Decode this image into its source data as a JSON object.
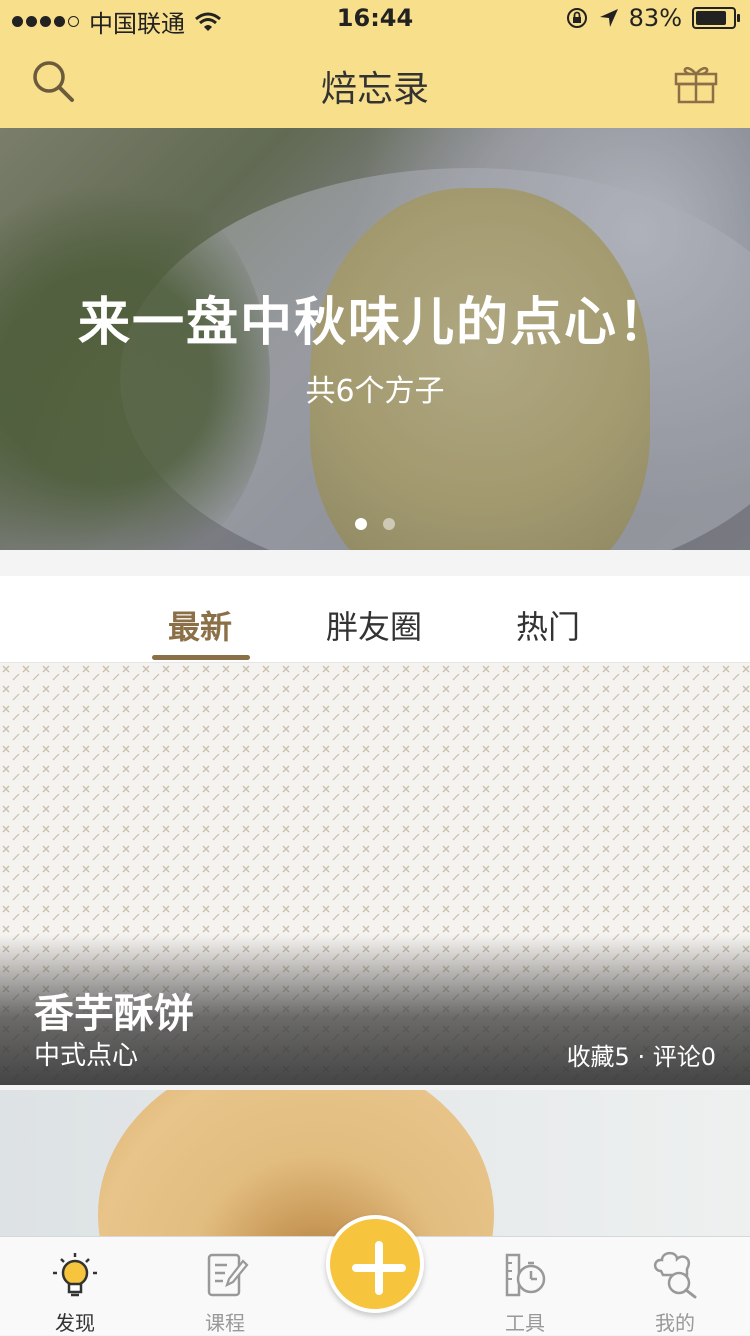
{
  "status_bar": {
    "carrier": "中国联通",
    "time": "16:44",
    "battery": "83%"
  },
  "nav": {
    "title": "焙忘录",
    "left_icon": "search-icon",
    "right_icon": "gift-icon"
  },
  "banner": {
    "headline": "来一盘中秋味儿的点心！",
    "subtitle": "共6个方子",
    "page_count": 2,
    "active_page": 0
  },
  "tabs": [
    {
      "label": "最新",
      "active": true
    },
    {
      "label": "胖友圈",
      "active": false
    },
    {
      "label": "热门",
      "active": false
    }
  ],
  "feed": [
    {
      "name": "香芋酥饼",
      "category": "中式点心",
      "stats": "收藏5 · 评论0"
    }
  ],
  "tab_bar": [
    {
      "label": "发现",
      "icon": "lightbulb-icon",
      "active": true
    },
    {
      "label": "课程",
      "icon": "notebook-icon",
      "active": false
    },
    {
      "label": "",
      "icon": "plus-icon",
      "active": false
    },
    {
      "label": "工具",
      "icon": "timer-icon",
      "active": false
    },
    {
      "label": "我的",
      "icon": "chef-icon",
      "active": false
    }
  ],
  "colors": {
    "header_bg": "#f8df8b",
    "accent": "#8b6f46",
    "fab": "#f6c53d"
  }
}
